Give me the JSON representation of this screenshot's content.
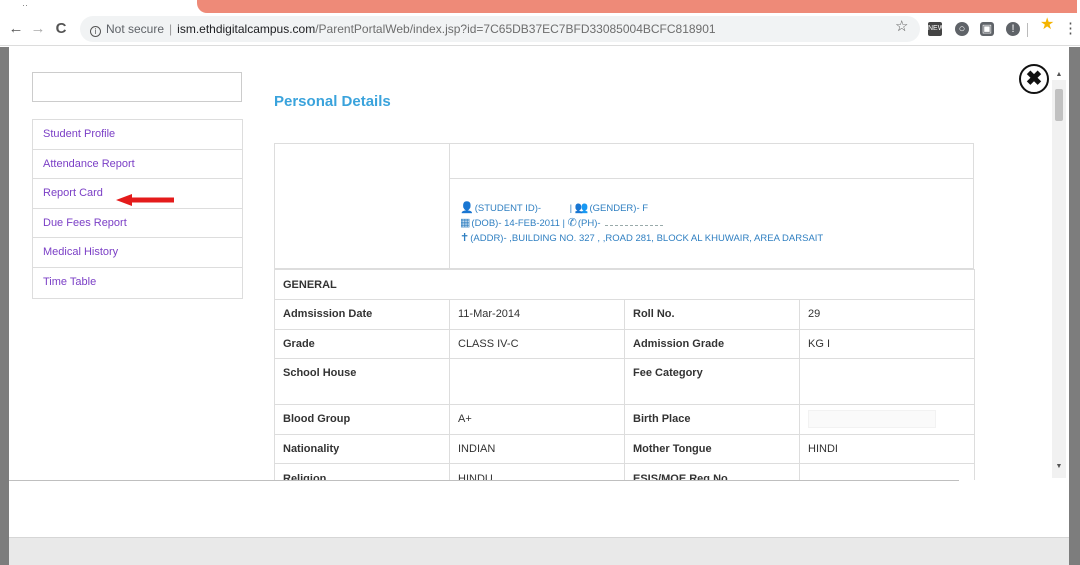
{
  "browser": {
    "tab_dots": "··",
    "back_icon": "←",
    "forward_icon": "→",
    "reload_icon": "C",
    "security_label": "Not secure",
    "url_host": "ism.ethdigitalcampus.com",
    "url_path": "/ParentPortalWeb/index.jsp?id=7C65DB37EC7BFD33085004BCFC818901",
    "star_icon": "☆",
    "menu_icon": "⋮"
  },
  "modal": {
    "close_icon": "✖"
  },
  "sidebar": {
    "items": [
      {
        "label": "Student Profile"
      },
      {
        "label": "Attendance Report"
      },
      {
        "label": "Report Card"
      },
      {
        "label": "Due Fees Report"
      },
      {
        "label": "Medical History"
      },
      {
        "label": "Time Table"
      }
    ]
  },
  "page": {
    "title": "Personal Details"
  },
  "profile": {
    "student_id": "(STUDENT ID)-",
    "gender": "(GENDER)- F",
    "dob": "(DOB)- 14-FEB-2011 |",
    "phone": "(PH)-",
    "address": "(ADDR)- ,BUILDING NO. 327 , ,ROAD 281, BLOCK AL KHUWAIR, AREA DARSAIT"
  },
  "details": {
    "section": "GENERAL",
    "rows": [
      {
        "l1": "Admsission Date",
        "v1": "11-Mar-2014",
        "l2": "Roll No.",
        "v2": "29"
      },
      {
        "l1": "Grade",
        "v1": "CLASS IV-C",
        "l2": "Admission Grade",
        "v2": "KG I"
      },
      {
        "l1": "School House",
        "v1": "",
        "l2": "Fee Category",
        "v2": ""
      },
      {
        "l1": "Blood Group",
        "v1": "A+",
        "l2": "Birth Place",
        "v2": ""
      },
      {
        "l1": "Nationality",
        "v1": "INDIAN",
        "l2": "Mother Tongue",
        "v2": "HINDI"
      },
      {
        "l1": "Religion",
        "v1": "HINDU",
        "l2": "ESIS/MOE Reg No.",
        "v2": ""
      }
    ]
  },
  "colors": {
    "accent": "#3aa3dc",
    "link": "#7b3fc6",
    "arrow": "#e41b1b",
    "tab_accent": "#ee8a78"
  }
}
